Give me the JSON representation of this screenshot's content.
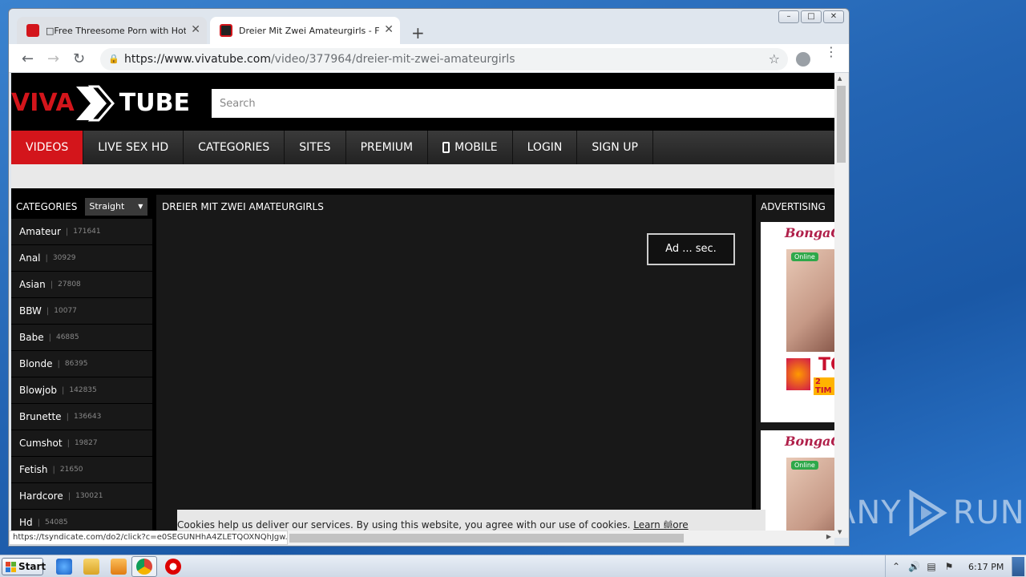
{
  "browser": {
    "tabs": [
      {
        "title": "□Free Threesome Porn with Hot Porn",
        "favicon_color": "#d3151b",
        "active": false
      },
      {
        "title": "Dreier Mit Zwei Amateurgirls - Free X",
        "favicon_color": "#222222",
        "active": true
      }
    ],
    "new_tab_label": "+",
    "url_scheme_host": "https://www.vivatube.com",
    "url_path": "/video/377964/dreier-mit-zwei-amateurgirls",
    "status_url": "https://tsyndicate.com/do2/click?c=e0SEGUNHhA4ZLETQOXNQhJgw..."
  },
  "site": {
    "logo_part1": "VIVA",
    "logo_part2": "TUBE",
    "search_placeholder": "Search",
    "nav": [
      "VIDEOS",
      "LIVE SEX HD",
      "CATEGORIES",
      "SITES",
      "PREMIUM",
      "MOBILE",
      "LOGIN",
      "SIGN UP"
    ],
    "accent_color": "#d3151b"
  },
  "sidebar": {
    "heading": "CATEGORIES",
    "filter_value": "Straight",
    "categories": [
      {
        "name": "Amateur",
        "count": "171641"
      },
      {
        "name": "Anal",
        "count": "30929"
      },
      {
        "name": "Asian",
        "count": "27808"
      },
      {
        "name": "BBW",
        "count": "10077"
      },
      {
        "name": "Babe",
        "count": "46885"
      },
      {
        "name": "Blonde",
        "count": "86395"
      },
      {
        "name": "Blowjob",
        "count": "142835"
      },
      {
        "name": "Brunette",
        "count": "136643"
      },
      {
        "name": "Cumshot",
        "count": "19827"
      },
      {
        "name": "Fetish",
        "count": "21650"
      },
      {
        "name": "Hardcore",
        "count": "130021"
      },
      {
        "name": "Hd",
        "count": "54085"
      }
    ]
  },
  "video": {
    "title": "DREIER MIT ZWEI AMATEURGIRLS",
    "ad_label": "Ad ... sec."
  },
  "advertising": {
    "heading": "ADVERTISING",
    "brand": "BongaCams",
    "online_label": "Online",
    "promo_big": "TO",
    "promo_small": "2 TIM"
  },
  "cookie": {
    "text": "Cookies help us deliver our services. By using this website, you agree with our use of cookies.",
    "link": "Learn more",
    "close": "✖"
  },
  "taskbar": {
    "start_label": "Start",
    "clock": "6:17 PM"
  },
  "watermark": "ANY RUN"
}
